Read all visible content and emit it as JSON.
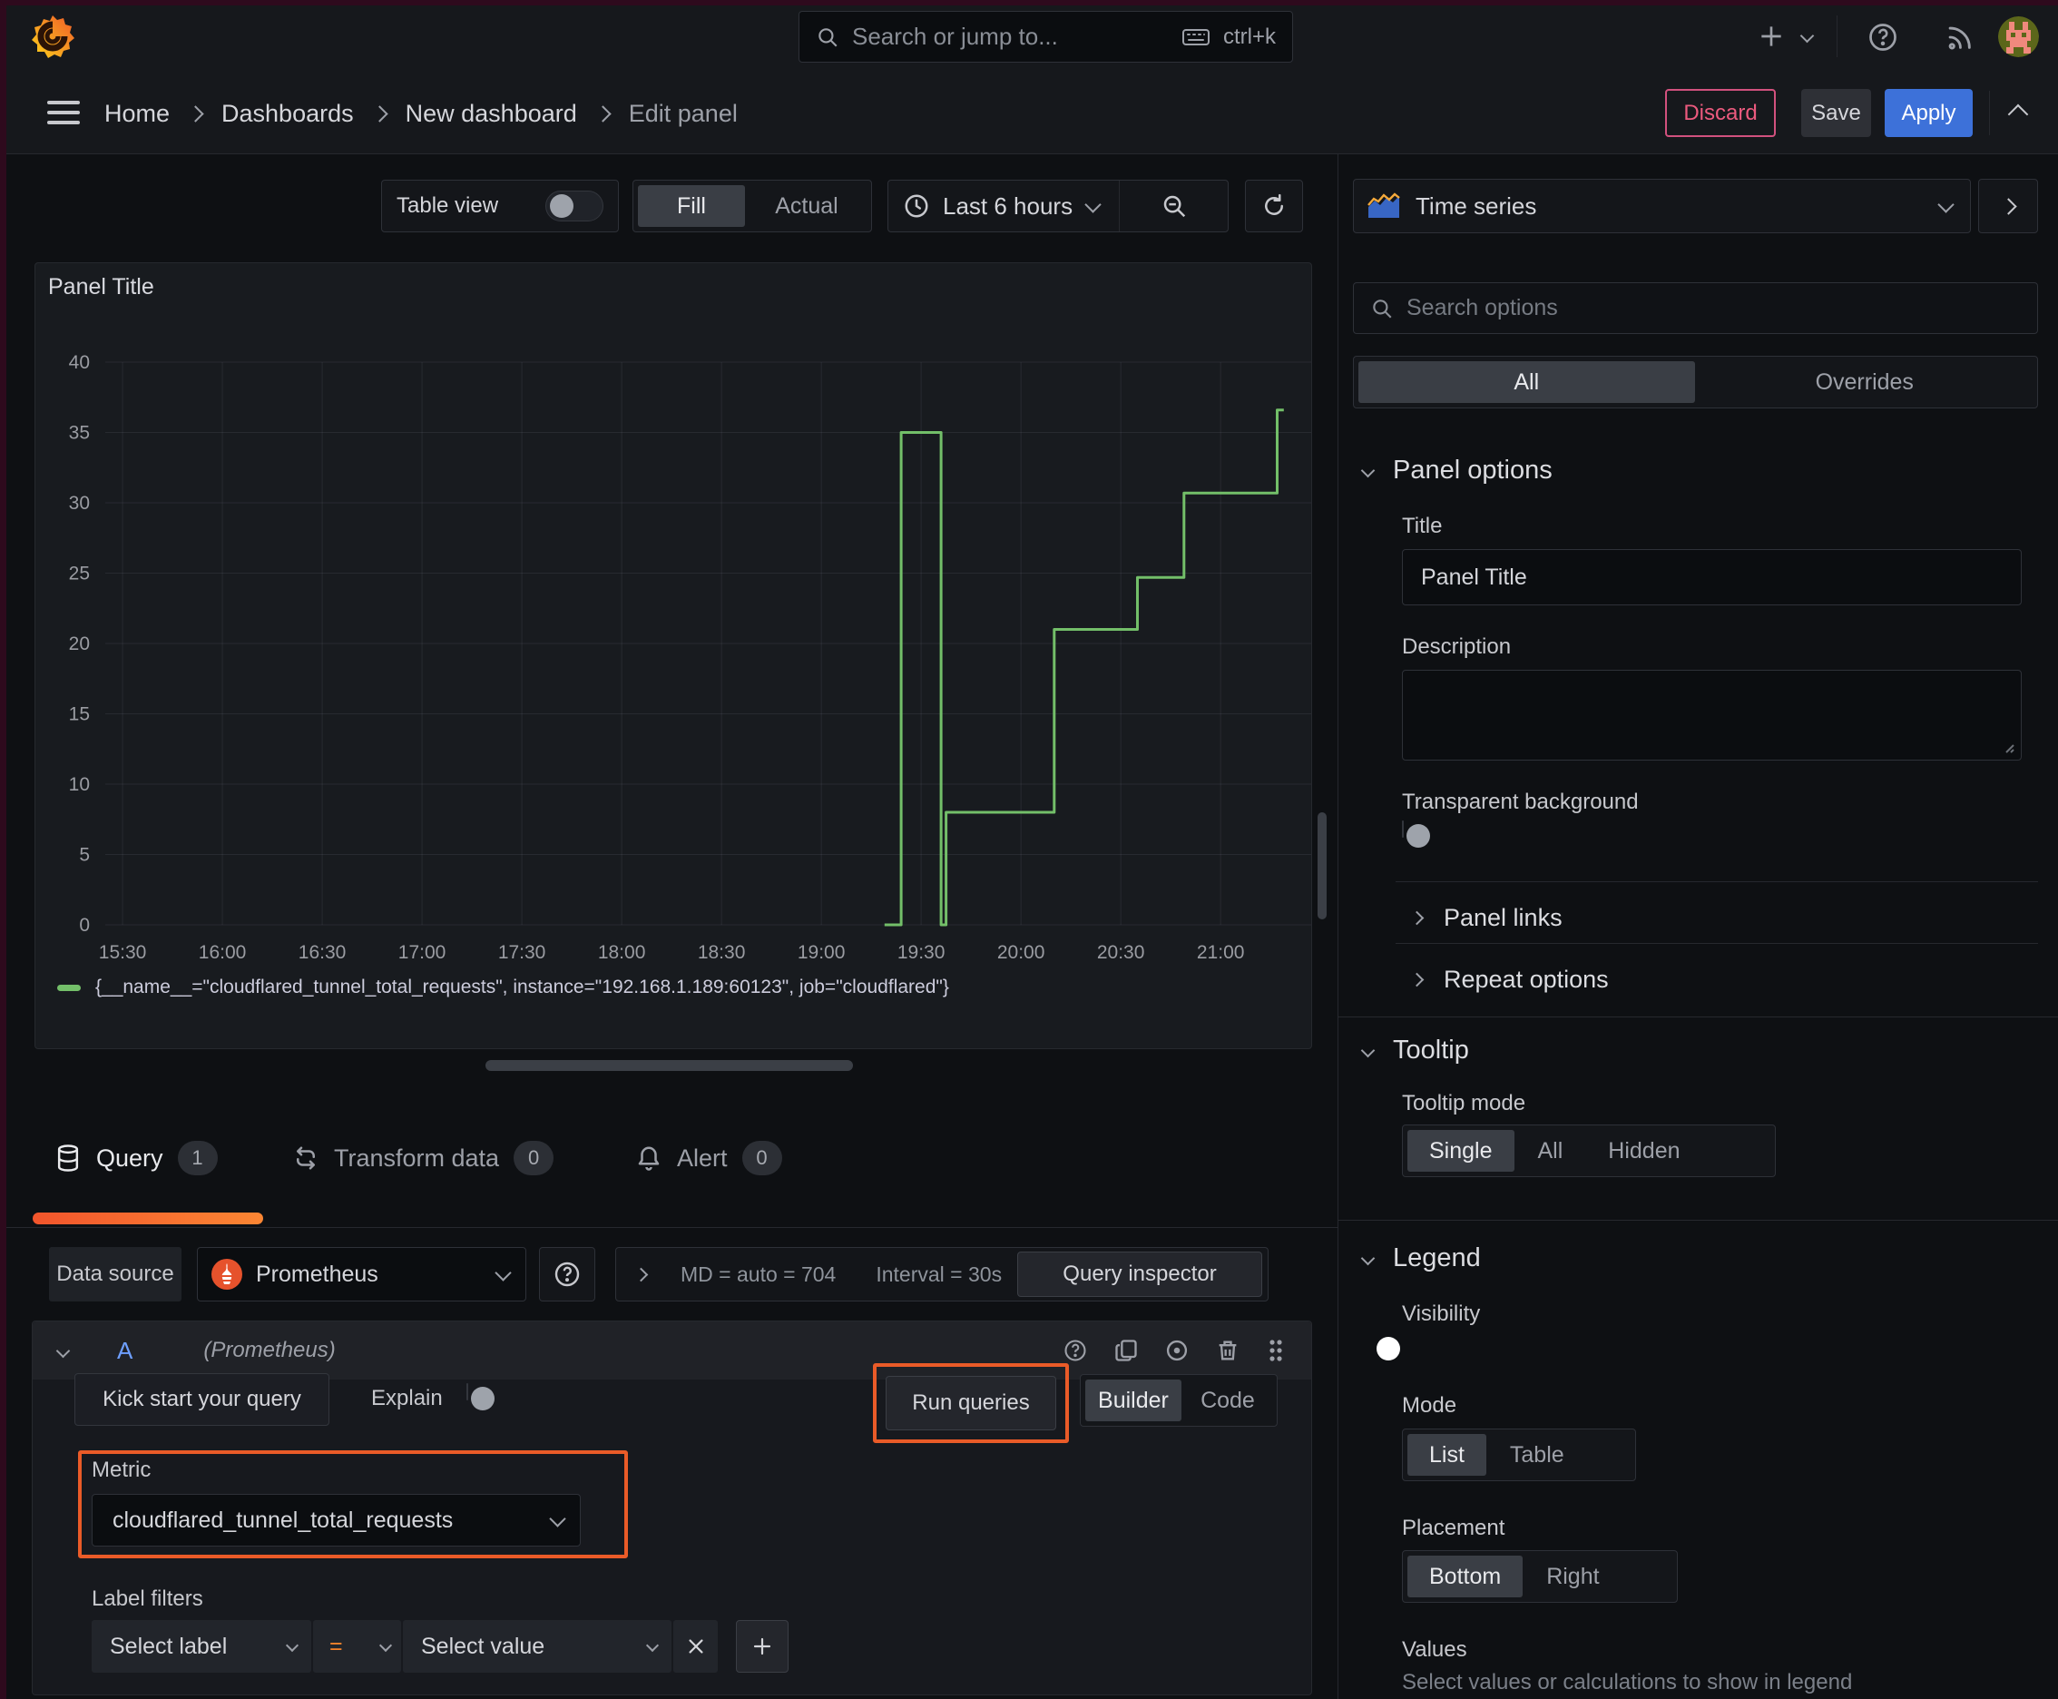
{
  "nav": {
    "search_placeholder": "Search or jump to...",
    "search_shortcut": "ctrl+k",
    "breadcrumbs": {
      "home": "Home",
      "dashboards": "Dashboards",
      "new_dashboard": "New dashboard",
      "edit_panel": "Edit panel"
    },
    "discard": "Discard",
    "save": "Save",
    "apply": "Apply"
  },
  "toolbar": {
    "table_view": "Table view",
    "fill": "Fill",
    "actual": "Actual",
    "time_range": "Last 6 hours"
  },
  "panel": {
    "title": "Panel Title"
  },
  "chart_data": {
    "type": "line",
    "title": "Panel Title",
    "xlabel": "",
    "ylabel": "",
    "x_axis": {
      "tick_minutes": [
        0,
        30,
        60,
        90,
        120,
        150,
        180,
        210,
        240,
        270,
        300,
        330
      ],
      "tick_labels": [
        "15:30",
        "16:00",
        "16:30",
        "17:00",
        "17:30",
        "18:00",
        "18:30",
        "19:00",
        "19:30",
        "20:00",
        "20:30",
        "21:00"
      ]
    },
    "y_axis": {
      "min": 0,
      "max": 40,
      "ticks": [
        0,
        5,
        10,
        15,
        20,
        25,
        30,
        35,
        40
      ]
    },
    "grid": true,
    "legend_position": "bottom",
    "series": [
      {
        "name": "{__name__=\"cloudflared_tunnel_total_requests\", instance=\"192.168.1.189:60123\", job=\"cloudflared\"}",
        "color": "#73BF69",
        "points_minutes_value": [
          [
            229,
            0
          ],
          [
            234,
            0
          ],
          [
            234,
            35
          ],
          [
            246,
            35
          ],
          [
            246,
            0
          ],
          [
            247.5,
            0
          ],
          [
            247.5,
            8
          ],
          [
            280,
            8
          ],
          [
            280,
            21
          ],
          [
            305,
            21
          ],
          [
            305,
            24.7
          ],
          [
            319,
            24.7
          ],
          [
            319,
            30.7
          ],
          [
            347,
            30.7
          ],
          [
            347,
            36.6
          ],
          [
            349,
            36.6
          ]
        ]
      }
    ]
  },
  "tabs": {
    "query": "Query",
    "query_count": "1",
    "transform": "Transform data",
    "transform_count": "0",
    "alert": "Alert",
    "alert_count": "0"
  },
  "datasource_row": {
    "label": "Data source",
    "name": "Prometheus",
    "md": "MD = auto = 704",
    "interval": "Interval = 30s",
    "inspector": "Query inspector"
  },
  "query": {
    "ref": "A",
    "hint": "(Prometheus)",
    "kick": "Kick start your query",
    "explain": "Explain",
    "run": "Run queries",
    "builder": "Builder",
    "code": "Code",
    "metric_label": "Metric",
    "metric": "cloudflared_tunnel_total_requests",
    "filters_label": "Label filters",
    "select_label": "Select label",
    "op": "=",
    "select_value": "Select value"
  },
  "sidebar": {
    "viz": "Time series",
    "search_placeholder": "Search options",
    "tab_all": "All",
    "tab_overrides": "Overrides",
    "panel_options": "Panel options",
    "title_label": "Title",
    "title_value": "Panel Title",
    "description_label": "Description",
    "transparent": "Transparent background",
    "panel_links": "Panel links",
    "repeat": "Repeat options",
    "tooltip": "Tooltip",
    "tooltip_mode": "Tooltip mode",
    "single": "Single",
    "all": "All",
    "hidden": "Hidden",
    "legend": "Legend",
    "visibility": "Visibility",
    "mode": "Mode",
    "list": "List",
    "table": "Table",
    "placement": "Placement",
    "bottom": "Bottom",
    "right": "Right",
    "values_label": "Values",
    "values_help": "Select values or calculations to show in legend"
  },
  "colors": {
    "series_green": "#73BF69",
    "apply_blue": "#3d71d9",
    "discard_pink": "#eb5a7e",
    "annotation_orange": "#ea5b28",
    "tab_underline": "#f2552c"
  }
}
